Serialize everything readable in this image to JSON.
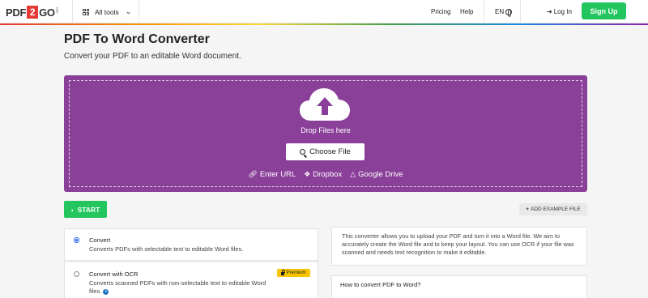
{
  "header": {
    "logo": {
      "part1": "PDF",
      "part2": "2",
      "part3": "GO",
      "suffix": ".com"
    },
    "all_tools": "All tools",
    "pricing": "Pricing",
    "help": "Help",
    "language": "EN",
    "login": "Log In",
    "signup": "Sign Up"
  },
  "page": {
    "title": "PDF To Word Converter",
    "subtitle": "Convert your PDF to an editable Word document."
  },
  "upload": {
    "drop_text": "Drop Files here",
    "choose_file": "Choose File",
    "enter_url": "Enter URL",
    "dropbox": "Dropbox",
    "google_drive": "Google Drive"
  },
  "actions": {
    "start": "START",
    "add_example": "ADD EXAMPLE FILE"
  },
  "options": [
    {
      "title": "Convert",
      "description": "Converts PDFs with selectable text to editable Word files.",
      "selected": true
    },
    {
      "title": "Convert with OCR",
      "description": "Converts scanned PDFs with non-selectable text to editable Word files.",
      "selected": false,
      "badge": "Premium"
    }
  ],
  "about_text": "This converter allows you to upload your PDF and turn it into a Word file. We aim to accurately create the Word file and to keep your layout. You can use OCR if your file was scanned and needs text recognition to make it editable.",
  "howto_title": "How to convert PDF to Word?",
  "colors": {
    "brand_purple": "#8a3f99",
    "green": "#22c55e",
    "premium": "#f7c600"
  }
}
